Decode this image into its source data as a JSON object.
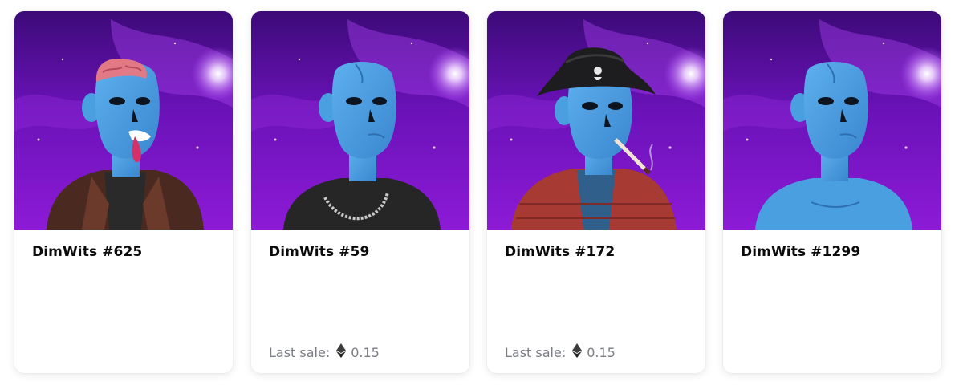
{
  "cards": [
    {
      "title": "DimWits #625",
      "last_sale": null,
      "traits": {
        "head": "exposed-brain",
        "mouth": "tongue-out",
        "clothing": "brown-leather-jacket"
      }
    },
    {
      "title": "DimWits #59",
      "last_sale": {
        "label": "Last sale:",
        "currency_icon": "ethereum-icon",
        "price": "0.15"
      },
      "traits": {
        "head": "none",
        "mouth": "neutral",
        "clothing": "black-tee-silver-chain"
      }
    },
    {
      "title": "DimWits #172",
      "last_sale": {
        "label": "Last sale:",
        "currency_icon": "ethereum-icon",
        "price": "0.15"
      },
      "traits": {
        "head": "black-pirate-hat",
        "mouth": "cigarette",
        "clothing": "red-puffer-vest"
      }
    },
    {
      "title": "DimWits #1299",
      "last_sale": null,
      "traits": {
        "head": "none",
        "mouth": "neutral",
        "clothing": "none"
      }
    }
  ],
  "colors": {
    "background_purple": "#6a12b8",
    "skin_blue": "#4a9fe0",
    "title_text": "#0b0b0b",
    "muted_text": "#7a7d85"
  }
}
